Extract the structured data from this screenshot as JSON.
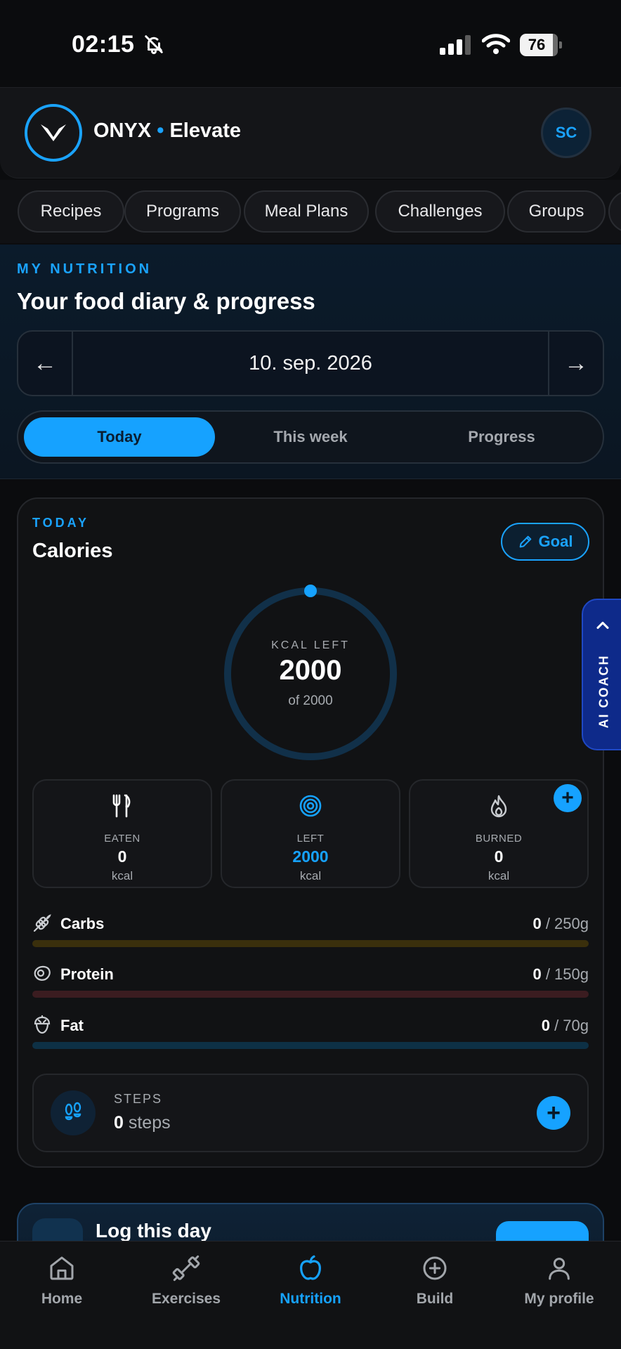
{
  "status_bar": {
    "time": "02:15",
    "battery": "76"
  },
  "header": {
    "brand_name": "ONYX",
    "brand_dot": "•",
    "brand_sub": "Elevate",
    "avatar_initials": "SC"
  },
  "chips": [
    "Recipes",
    "Programs",
    "Meal Plans",
    "Challenges",
    "Groups"
  ],
  "nutrition": {
    "eyebrow": "MY NUTRITION",
    "title": "Your food diary & progress",
    "date": "10. sep. 2026",
    "prev_arrow": "←",
    "next_arrow": "→",
    "tabs": [
      "Today",
      "This week",
      "Progress"
    ],
    "active_tab": "Today"
  },
  "calories": {
    "eyebrow": "TODAY",
    "title": "Calories",
    "goal_label": "Goal",
    "ring_label": "KCAL LEFT",
    "ring_value": "2000",
    "ring_of": "of 2000",
    "progress_fraction": 0,
    "stats": [
      {
        "label": "EATEN",
        "value": "0",
        "unit": "kcal"
      },
      {
        "label": "LEFT",
        "value": "2000",
        "unit": "kcal"
      },
      {
        "label": "BURNED",
        "value": "0",
        "unit": "kcal"
      }
    ],
    "macros": [
      {
        "name": "Carbs",
        "current": "0",
        "goal": " / 250g",
        "progress": 0,
        "color": "#3a2f0c"
      },
      {
        "name": "Protein",
        "current": "0",
        "goal": " / 150g",
        "progress": 0,
        "color": "#3b1c20"
      },
      {
        "name": "Fat",
        "current": "0",
        "goal": " / 70g",
        "progress": 0,
        "color": "#0d3045"
      }
    ],
    "steps": {
      "label": "STEPS",
      "value": "0",
      "unit": "steps"
    }
  },
  "log_day": {
    "title": "Log this day"
  },
  "ai_coach": {
    "label": "AI COACH"
  },
  "bottom_nav": [
    {
      "label": "Home",
      "icon": "home-icon"
    },
    {
      "label": "Exercises",
      "icon": "dumbbell-icon"
    },
    {
      "label": "Nutrition",
      "icon": "apple-icon"
    },
    {
      "label": "Build",
      "icon": "plus-circle-icon"
    },
    {
      "label": "My profile",
      "icon": "user-icon"
    }
  ],
  "colors": {
    "accent": "#16a2ff",
    "background": "#0b0c0e",
    "ring_track": "#113049"
  }
}
